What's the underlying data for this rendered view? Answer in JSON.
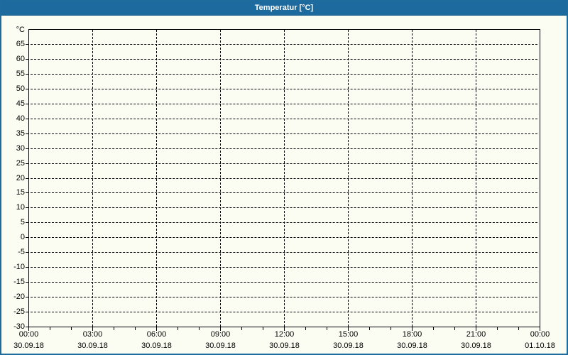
{
  "window": {
    "title": "Temperatur [°C]"
  },
  "colors": {
    "titlebar_bg": "#1d6a9e",
    "window_border": "#1e6b9e",
    "titlebar_text": "#ffffff",
    "content_bg": "#fbfdf3",
    "grid_line": "#000000",
    "axis_text": "#000000"
  },
  "chart_data": {
    "type": "line",
    "title": "Temperatur [°C]",
    "xlabel": "",
    "ylabel": "°C",
    "series": [],
    "grid": "dashed",
    "legend": "none",
    "y_axis": {
      "unit": "°C",
      "min": -30,
      "max": 70,
      "tick_step": 5,
      "ticks": [
        65,
        60,
        55,
        50,
        45,
        40,
        35,
        30,
        25,
        20,
        15,
        10,
        5,
        0,
        -5,
        -10,
        -15,
        -20,
        -25,
        -30
      ]
    },
    "x_axis": {
      "min_hours": 0,
      "max_hours": 24,
      "minor_step_hours": 1,
      "major_step_hours": 3,
      "major_ticks": [
        {
          "time": "00:00",
          "date": "30.09.18"
        },
        {
          "time": "03:00",
          "date": "30.09.18"
        },
        {
          "time": "06:00",
          "date": "30.09.18"
        },
        {
          "time": "09:00",
          "date": "30.09.18"
        },
        {
          "time": "12:00",
          "date": "30.09.18"
        },
        {
          "time": "15:00",
          "date": "30.09.18"
        },
        {
          "time": "18:00",
          "date": "30.09.18"
        },
        {
          "time": "21:00",
          "date": "30.09.18"
        },
        {
          "time": "00:00",
          "date": "01.10.18"
        }
      ]
    }
  }
}
